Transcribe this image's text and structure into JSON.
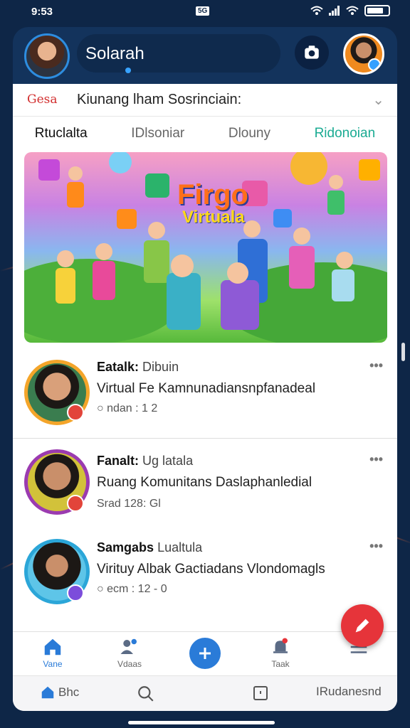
{
  "status": {
    "time": "9:53",
    "network": "5G"
  },
  "header": {
    "title": "Solarah"
  },
  "community": {
    "brand": "Gesa",
    "title": "Kiunang lham Sosrinciain:"
  },
  "tabs": [
    {
      "label": "Rtuclalta"
    },
    {
      "label": "IDlsoniar"
    },
    {
      "label": "Dlouny"
    },
    {
      "label": "Ridonoian"
    }
  ],
  "banner": {
    "line1": "Firgo",
    "line2": "Virtuala"
  },
  "posts": [
    {
      "name": "Eatalk:",
      "sub": "Dibuin",
      "body": "Virtual Fe Kamnunadiansnpfanadeal",
      "meta": "ndan : 1 2"
    },
    {
      "name": "Fanalt:",
      "sub": "Ug latala",
      "body": "Ruang Komunitans Daslaphanledial",
      "meta": "Srad 128: Gl"
    },
    {
      "name": "Samgabs",
      "sub": "Lualtula",
      "body": "Virituy Albak Gactiadans Vlondomagls",
      "meta": "ecm : 12 - 0"
    }
  ],
  "nav": [
    {
      "label": "Vane"
    },
    {
      "label": "Vdaas"
    },
    {
      "label": ""
    },
    {
      "label": "Taak"
    },
    {
      "label": ""
    }
  ],
  "bottombar": {
    "home": "Bhc",
    "right": "IRudanesnd"
  },
  "colors": {
    "accent": "#2a7bd8",
    "fab": "#e6343a",
    "background": "#0e2647"
  }
}
